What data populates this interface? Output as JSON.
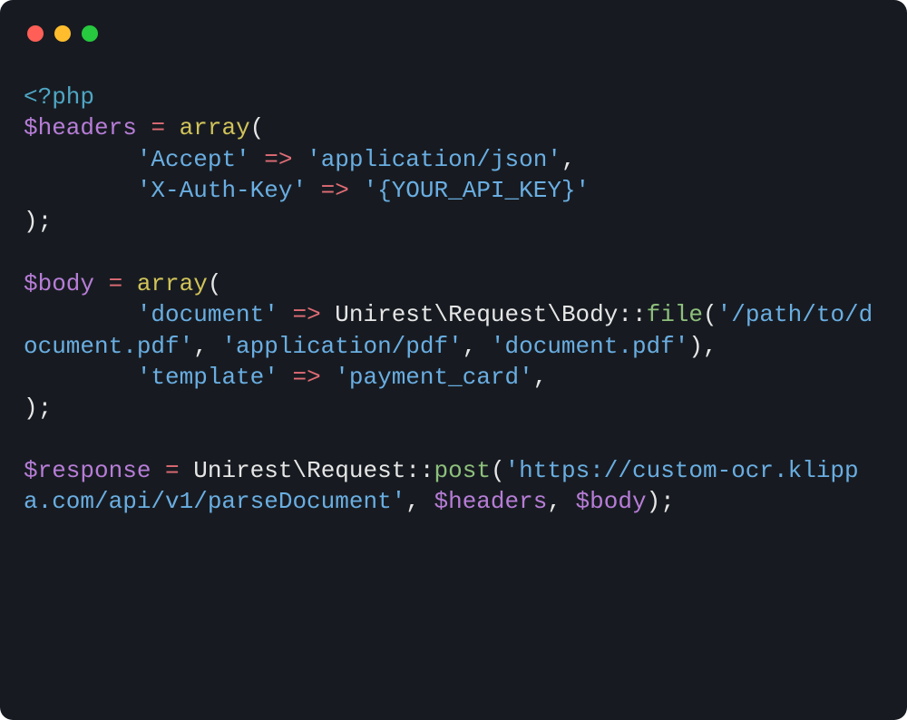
{
  "code": {
    "open_tag": "<?php",
    "var_headers": "$headers",
    "var_body": "$body",
    "var_response": "$response",
    "eq": "=",
    "fn_array": "array",
    "arrow": "=>",
    "lp": "(",
    "rp": ")",
    "semi": ";",
    "comma": ",",
    "bslash": "\\",
    "dcolon": "::",
    "indent": "        ",
    "close_paren_semi": ");",
    "ns1": "Unirest",
    "ns2": "Request",
    "ns3": "Body",
    "m_file": "file",
    "m_post": "post",
    "s_accept": "'Accept'",
    "s_appjson": "'application/json'",
    "s_xauth": "'X-Auth-Key'",
    "s_apikey": "'{YOUR_API_KEY}'",
    "s_document": "'document'",
    "s_path": "'/path/to/document.pdf'",
    "s_apppdf": "'application/pdf'",
    "s_docpdf": "'document.pdf'",
    "s_template": "'template'",
    "s_paycard": "'payment_card'",
    "s_url": "'https://custom-ocr.klippa.com/api/v1/parseDocument'"
  },
  "window": {
    "platform": "mac"
  }
}
